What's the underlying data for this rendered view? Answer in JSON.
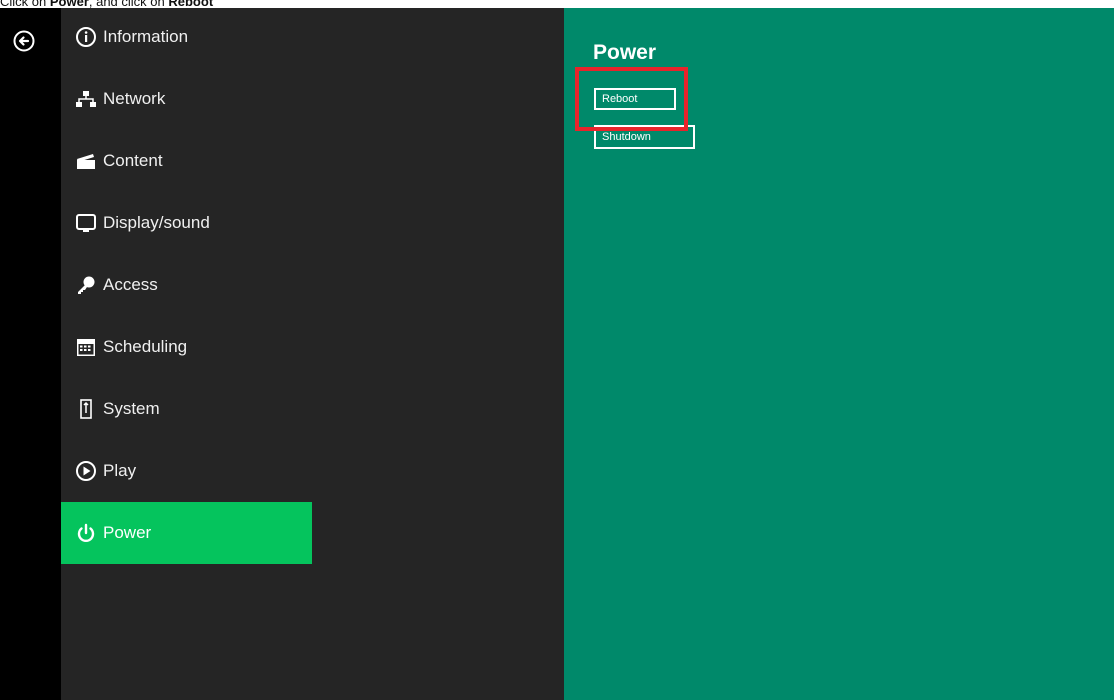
{
  "instruction": {
    "part1": "Click on ",
    "emph1": "Power",
    "part2": ", and click on ",
    "emph2": "Reboot"
  },
  "rail": {
    "back_icon": "back-arrow-circle-icon"
  },
  "sidebar": {
    "items": [
      {
        "label": "Information",
        "icon": "info-circle-icon",
        "active": false
      },
      {
        "label": "Network",
        "icon": "network-icon",
        "active": false
      },
      {
        "label": "Content",
        "icon": "clapperboard-icon",
        "active": false
      },
      {
        "label": "Display/sound",
        "icon": "monitor-icon",
        "active": false
      },
      {
        "label": "Access",
        "icon": "key-icon",
        "active": false
      },
      {
        "label": "Scheduling",
        "icon": "calendar-icon",
        "active": false
      },
      {
        "label": "System",
        "icon": "system-icon",
        "active": false
      },
      {
        "label": "Play",
        "icon": "play-circle-icon",
        "active": false
      },
      {
        "label": "Power",
        "icon": "power-icon",
        "active": true
      }
    ]
  },
  "main": {
    "title": "Power",
    "reboot_label": "Reboot",
    "shutdown_label": "Shutdown"
  },
  "colors": {
    "rail": "#000000",
    "sidebar": "#252525",
    "active": "#05c45d",
    "main": "#00896a",
    "highlight": "#e8242b"
  }
}
